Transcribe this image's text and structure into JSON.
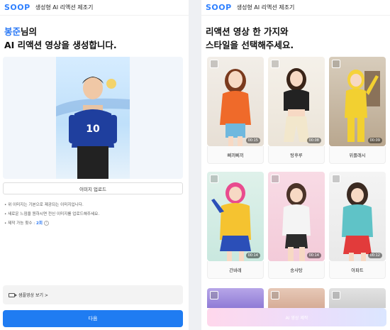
{
  "left": {
    "header": {
      "logo": "SOOP",
      "title": "생성형 AI 리액션 제조기"
    },
    "heading": {
      "name": "봉준",
      "suffix": "님의",
      "line2": "AI 리액션 영상을 생성합니다."
    },
    "upload_button": "이미지 업로드",
    "notes": [
      "위 이미지는 기본으로 제공되는 이미지입니다.",
      "새로운 느낌을 원하시면 전신 이미지를 업로드해주세요."
    ],
    "count": {
      "label": "제작 가능 횟수 : ",
      "value": "2회",
      "info_icon": "info-icon"
    },
    "sample_link": "샘플영상 보기 >",
    "next_button": "다음"
  },
  "right": {
    "header": {
      "logo": "SOOP",
      "title": "생성형 AI 리액션 제조기"
    },
    "heading": {
      "line1": "리액션 영상 한 가지와",
      "line2": "스타일을 선택해주세요."
    },
    "styles": [
      {
        "label": "삐끼삐끼",
        "duration": "00:15"
      },
      {
        "label": "탕후루",
        "duration": "00:08"
      },
      {
        "label": "위플래시",
        "duration": "00:09"
      },
      {
        "label": "간바레",
        "duration": "00:14"
      },
      {
        "label": "송사탕",
        "duration": "00:14"
      },
      {
        "label": "아파트",
        "duration": "00:12"
      }
    ],
    "create_button": "AI 영상 제작"
  },
  "colors": {
    "accent": "#1f7cf2",
    "name_highlight": "#2f7bf5"
  }
}
